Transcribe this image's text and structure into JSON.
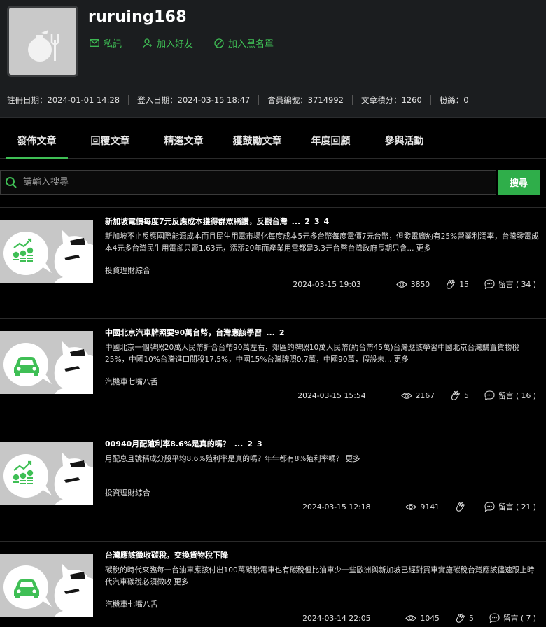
{
  "profile": {
    "username": "ruruing168",
    "actions": {
      "message": "私訊",
      "add_friend": "加入好友",
      "blacklist": "加入黑名單"
    },
    "stats": {
      "register": "註冊日期：2024-01-01 14:28",
      "login": "登入日期：2024-03-15 18:47",
      "member_no": "會員編號：3714992",
      "points": "文章積分：1260",
      "fans": "粉絲：0"
    }
  },
  "tabs": [
    "發佈文章",
    "回覆文章",
    "精選文章",
    "獲鼓勵文章",
    "年度回顧",
    "參與活動"
  ],
  "search": {
    "placeholder": "請輸入搜尋",
    "button": "搜尋"
  },
  "articles": [
    {
      "icon": "coins-chart-icon",
      "title": "新加坡電價每度7元反應成本獲得群眾稱讚，反觀台灣",
      "pages": [
        "...",
        "2",
        "3",
        "4"
      ],
      "excerpt": "新加坡不止反應國際能源成本而且民生用電市場化每度成本5元多台幣每度電價7元台幣，但發電廠約有25%營業利潤率，台灣發電成本4元多台灣民生用電卻只賣1.63元，漲漲20年而產業用電都是3.3元台幣台灣政府長期只會...",
      "more": "更多",
      "category": "投資理財綜合",
      "date": "2024-03-15 19:03",
      "views": "3850",
      "likes": "15",
      "comments": "留言 ( 34 )"
    },
    {
      "icon": "car-icon",
      "title": "中國北京汽車牌照要90萬台幣，台灣應該學習",
      "pages": [
        "...",
        "2"
      ],
      "excerpt": "中國北京一個牌照20萬人民幣折合台幣90萬左右，郊區的牌照10萬人民幣(約台幣45萬)台灣應該學習中國北京台灣購置貨物稅25%，中國10%台灣進口關稅17.5%，中國15%台灣牌照0.7萬，中國90萬，假設未...",
      "more": "更多",
      "category": "汽機車七嘴八舌",
      "date": "2024-03-15 15:54",
      "views": "2167",
      "likes": "5",
      "comments": "留言 ( 16 )"
    },
    {
      "icon": "coins-chart-icon",
      "title": "00940月配殖利率8.6%是真的嗎？",
      "pages": [
        "...",
        "2",
        "3"
      ],
      "excerpt": "月配息且號稱成分股平均8.6%殖利率是真的嗎？年年都有8%殖利率嗎？",
      "more": "更多",
      "category": "投資理財綜合",
      "date": "2024-03-15 12:18",
      "views": "9141",
      "likes": "",
      "comments": "留言 ( 21 )"
    },
    {
      "icon": "car-icon",
      "title": "台灣應該徵收碳稅，交換貨物稅下降",
      "pages": [],
      "excerpt": "碳稅的時代來臨每一台油車應該付出100萬碳稅電車也有碳稅但比油車少一些歐洲與新加坡已經對買車實施碳稅台灣應該儘速跟上時代汽車碳稅必須徵收",
      "more": "更多",
      "category": "汽機車七嘴八舌",
      "date": "2024-03-14 22:05",
      "views": "1045",
      "likes": "5",
      "comments": "留言 ( 7 )"
    }
  ],
  "colors": {
    "accent": "#3fbf55",
    "background": "#000000",
    "header": "#1b1d1f"
  }
}
